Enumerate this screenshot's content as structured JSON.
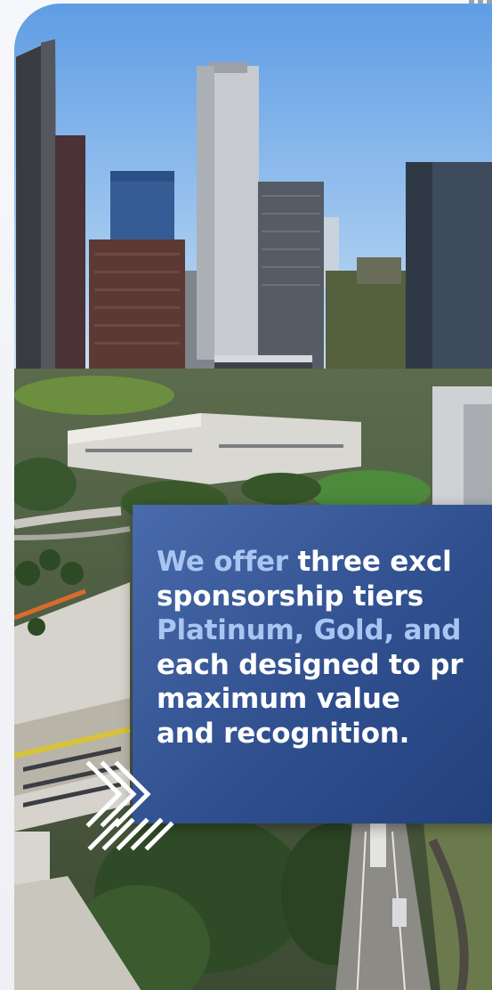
{
  "hero": {
    "image_subject": "downtown-los-angeles-skyline-photo"
  },
  "message": {
    "line1_accent": "We offer",
    "line1_rest": " three excl",
    "line2": "sponsorship tiers",
    "line3_accent": "Platinum, Gold, and",
    "line4": "each designed to pr",
    "line5": "maximum value",
    "line6": "and recognition."
  },
  "colors": {
    "panel": "#2f4f8e",
    "accent_text": "#a9c6f2",
    "body_text": "#ffffff",
    "sky": "#7fb2ea"
  }
}
